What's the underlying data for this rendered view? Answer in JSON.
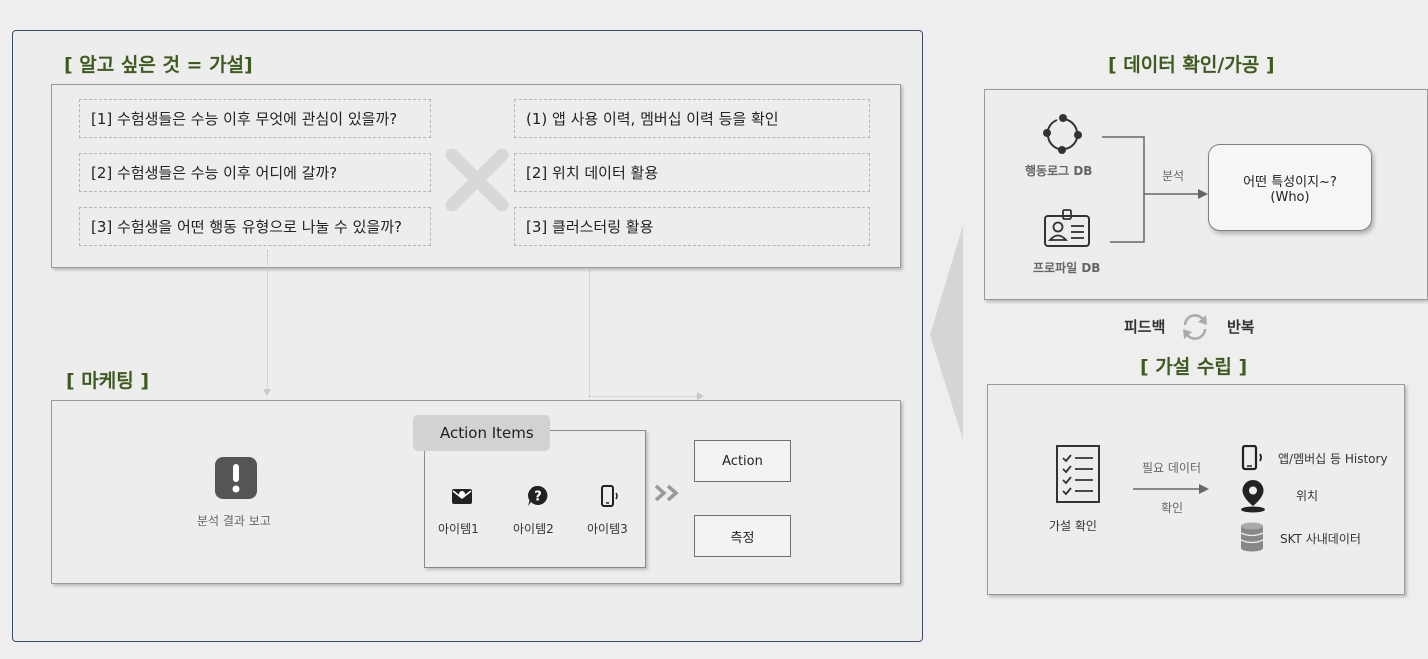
{
  "colors": {
    "title_green": "#3f5a1f",
    "frame_border": "#3d4a66",
    "icon_dark": "#222222",
    "icon_gray": "#555555"
  },
  "hypothesis": {
    "title": "[ 알고 싶은 것 = 가설]",
    "questions": [
      "[1] 수험생들은 수능 이후 무엇에 관심이 있을까?",
      "[2] 수험생들은 수능 이후 어디에 갈까?",
      "[3] 수험생을 어떤 행동 유형으로 나눌 수 있을까?"
    ],
    "methods": [
      "(1) 앱 사용 이력, 멤버십 이력 등을 확인",
      "[2] 위치 데이터 활용",
      "[3] 클러스터링 활용"
    ]
  },
  "marketing": {
    "title": "[ 마케팅 ]",
    "report_label": "분석 결과 보고",
    "action_items_title": "Action Items",
    "items": [
      {
        "icon": "mail-icon",
        "label": "아이템1"
      },
      {
        "icon": "chat-question-icon",
        "label": "아이템2"
      },
      {
        "icon": "phone-icon",
        "label": "아이템3"
      }
    ],
    "action_label": "Action",
    "measure_label": "측정"
  },
  "data_check": {
    "title": "[ 데이터 확인/가공 ]",
    "behavior_db": "행동로그 DB",
    "profile_db": "프로파일 DB",
    "analysis_label": "분석",
    "result_line1": "어떤 특성이지~?",
    "result_line2": "(Who)"
  },
  "feedback": {
    "left": "피드백",
    "right": "반복"
  },
  "hypothesis_setup": {
    "title": "[ 가설 수립 ]",
    "confirm_label": "가설 확인",
    "needed_data": "필요 데이터",
    "check": "확인",
    "sources": [
      {
        "icon": "phone-icon",
        "label": "앱/멤버십 등 History"
      },
      {
        "icon": "location-pin-icon",
        "label": "위치"
      },
      {
        "icon": "database-icon",
        "label": "SKT 사내데이터"
      }
    ]
  }
}
